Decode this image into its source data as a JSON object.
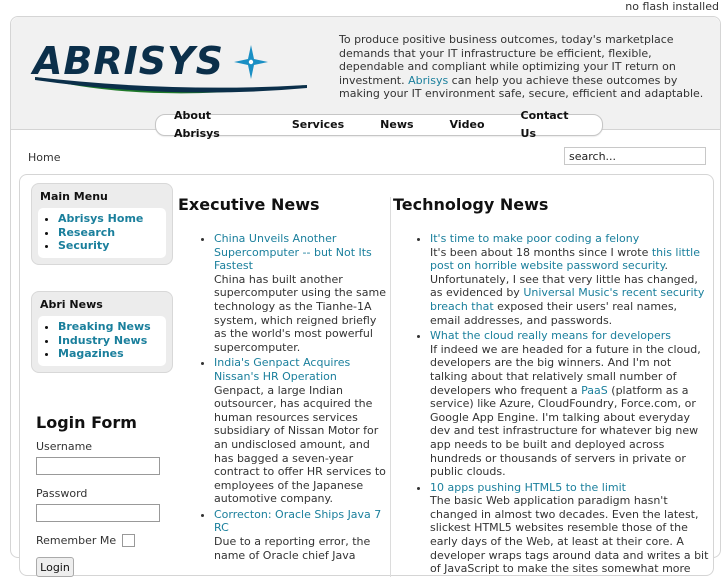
{
  "flash_note": "no flash installed",
  "header": {
    "logo_text": "ABRISYS",
    "intro_before": "To produce positive business outcomes, today's marketplace demands that your IT infrastructure be efficient, flexible, dependable and compliant while optimizing your IT return on investment. ",
    "intro_link": "Abrisys",
    "intro_after": " can help you achieve these outcomes by making your IT environment safe, secure, efficient and adaptable."
  },
  "nav": [
    "About Abrisys",
    "Services",
    "News",
    "Video",
    "Contact Us"
  ],
  "breadcrumb": "Home",
  "search": {
    "value": "search..."
  },
  "main_menu": {
    "title": "Main Menu",
    "items": [
      "Abrisys Home",
      "Research",
      "Security"
    ]
  },
  "abri_news": {
    "title": "Abri News",
    "items": [
      "Breaking News",
      "Industry News",
      "Magazines"
    ]
  },
  "login": {
    "title": "Login Form",
    "username_label": "Username",
    "password_label": "Password",
    "remember_label": "Remember Me",
    "button": "Login"
  },
  "executive_news": {
    "title": "Executive News",
    "items": [
      {
        "link": "China Unveils Another Supercomputer -- but Not Its Fastest",
        "text": "China has built another supercomputer using the same technology as the Tianhe-1A system, which reigned briefly as the world's most powerful supercomputer."
      },
      {
        "link": "India's Genpact Acquires Nissan's HR Operation",
        "text": "Genpact, a large Indian outsourcer, has acquired the human resources services subsidiary of Nissan Motor for an undisclosed amount, and has bagged a seven-year contract to offer HR services to employees of the Japanese automotive company."
      },
      {
        "link": "Correcton: Oracle Ships Java 7 RC",
        "text": "Due to a reporting error, the name of Oracle chief Java"
      }
    ]
  },
  "tech_news": {
    "title": "Technology News",
    "item1": {
      "link": "It's time to make poor coding a felony",
      "t1": "It's been about 18 months since I wrote ",
      "l2": "this little post on horrible website password security",
      "t2": ". Unfortunately, I see that very little has changed, as evidenced by ",
      "l3": "Universal Music's recent security breach that",
      "t3": " exposed their users' real names, email addresses, and passwords."
    },
    "item2": {
      "link": "What the cloud really means for developers",
      "t1": "If indeed we are headed for a future in the cloud, developers are the big winners. And I'm not talking about that relatively small number of developers who frequent a ",
      "l2": "PaaS",
      "t2": " (platform as a service) like Azure, CloudFoundry, Force.com, or Google App Engine. I'm talking about everyday dev and test infrastructure for whatever big new app needs to be built and deployed across hundreds or thousands of servers in private or public clouds."
    },
    "item3": {
      "link": "10 apps pushing HTML5 to the limit",
      "t1": "The basic Web application paradigm hasn't changed in almost two decades. Even the latest, slickest HTML5 websites resemble those of the early days of the Web, at least at their core. A developer wraps tags around data and writes a bit of JavaScript to make the sites somewhat more"
    }
  },
  "colors": {
    "link": "#1a7f9c",
    "header_bg": "#f1f1f1",
    "logo_dark": "#0b2f4a",
    "logo_green": "#2f7a2f"
  }
}
